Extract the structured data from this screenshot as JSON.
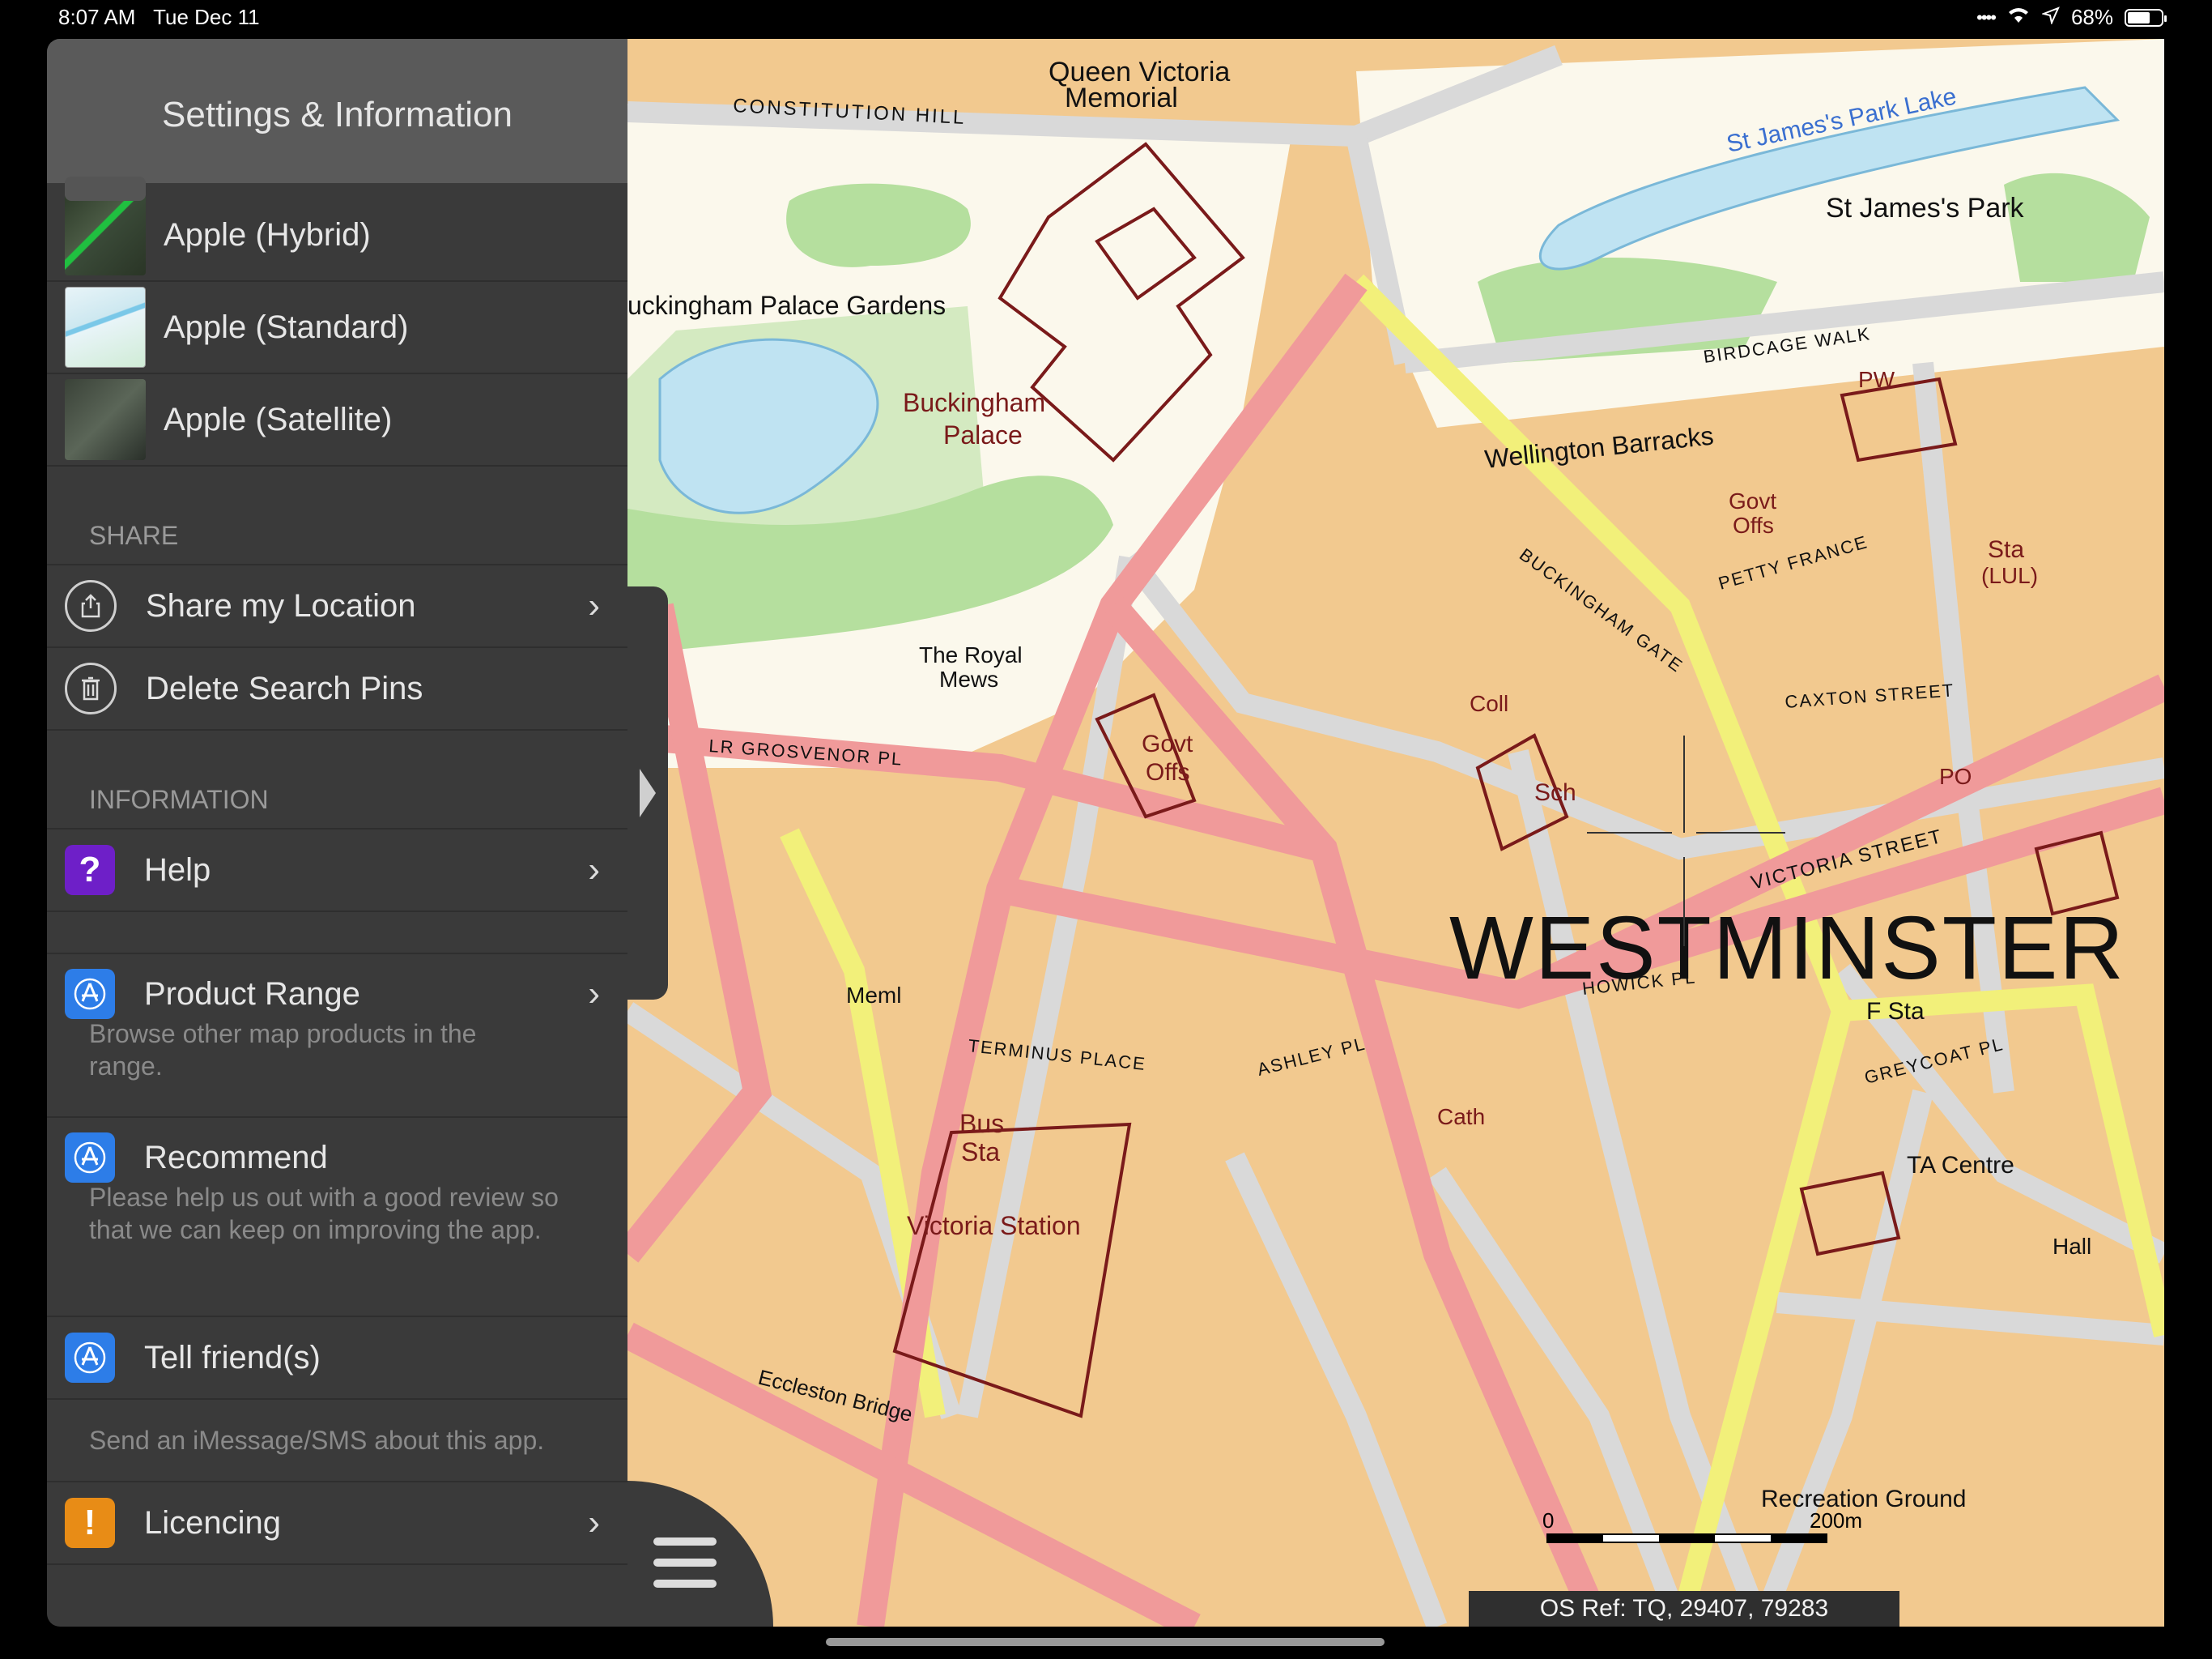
{
  "status_bar": {
    "time": "8:07 AM",
    "date": "Tue Dec 11",
    "battery": "68%",
    "battery_level": 0.68
  },
  "panel": {
    "title": "Settings & Information",
    "map_types": [
      {
        "label": "Apple (Hybrid)",
        "thumb": "hybrid"
      },
      {
        "label": "Apple (Standard)",
        "thumb": "standard"
      },
      {
        "label": "Apple (Satellite)",
        "thumb": "satellite"
      }
    ],
    "share": {
      "header": "SHARE",
      "items": [
        {
          "label": "Share my Location",
          "icon": "share-icon"
        },
        {
          "label": "Delete Search Pins",
          "icon": "trash-icon"
        }
      ]
    },
    "information": {
      "header": "INFORMATION",
      "help": {
        "label": "Help",
        "icon": "question-icon"
      },
      "product_range": {
        "label": "Product Range",
        "desc": "Browse other map products in the range.",
        "icon": "app-store-icon"
      },
      "recommend": {
        "label": "Recommend",
        "desc": "Please help us out with a good review so that we can keep on improving the app.",
        "icon": "app-store-icon"
      },
      "tell_friends": {
        "label": "Tell friend(s)",
        "desc": "Send an iMessage/SMS about this app.",
        "icon": "app-store-icon"
      },
      "licencing": {
        "label": "Licencing",
        "icon": "exclamation-icon"
      }
    }
  },
  "map": {
    "district": "WESTMINSTER",
    "labels": {
      "queen_victoria": [
        "Queen Victoria",
        "Memorial"
      ],
      "constitution_hill": "CONSTITUTION HILL",
      "st_james_lake": "St James's Park Lake",
      "st_james_park": "St James's Park",
      "palace_gardens": "uckingham Palace Gardens",
      "palace": [
        "Buckingham",
        "Palace"
      ],
      "birdcage_walk": "BIRDCAGE WALK",
      "wellington": "Wellington Barracks",
      "royal_mews": [
        "The Royal",
        "Mews"
      ],
      "govt_offs_1": [
        "Govt",
        "Offs"
      ],
      "govt_offs_2": [
        "Govt",
        "Offs"
      ],
      "victoria_station": "Victoria Station",
      "bus_sta": [
        "Bus",
        "Sta"
      ],
      "victoria_street": "VICTORIA STREET",
      "recreation_ground": "Recreation Ground",
      "ta_centre": "TA Centre",
      "caxton_street": "CAXTON STREET",
      "buckingham_gate": "BUCKINGHAM GATE",
      "petty_france": "PETTY FRANCE",
      "ashley_pl": "ASHLEY PL",
      "eccleston_bridge": "Eccleston Bridge",
      "grosvenor_pl": "LR GROSVENOR PL",
      "terminus_place": "TERMINUS PLACE",
      "howick_pl": "HOWICK PL",
      "greycoat_pl": "GREYCOAT PL",
      "pw": "PW",
      "coll": "Coll",
      "sch": "Sch",
      "po": "PO",
      "memi": "Meml",
      "cath": "Cath",
      "hall": "Hall",
      "f_sta": "F Sta",
      "sta_lul": [
        "Sta",
        "(LUL)"
      ]
    },
    "scale": {
      "start": "0",
      "end": "200m"
    },
    "os_ref": "OS Ref: TQ, 29407, 79283"
  },
  "colors": {
    "map_building": "#f2c98f",
    "map_road_a": "#f09a9a",
    "map_road_b": "#f2f07a",
    "map_park": "#b5df9e",
    "map_water": "#bfe3f2",
    "panel_bg": "#3a3a3a"
  }
}
